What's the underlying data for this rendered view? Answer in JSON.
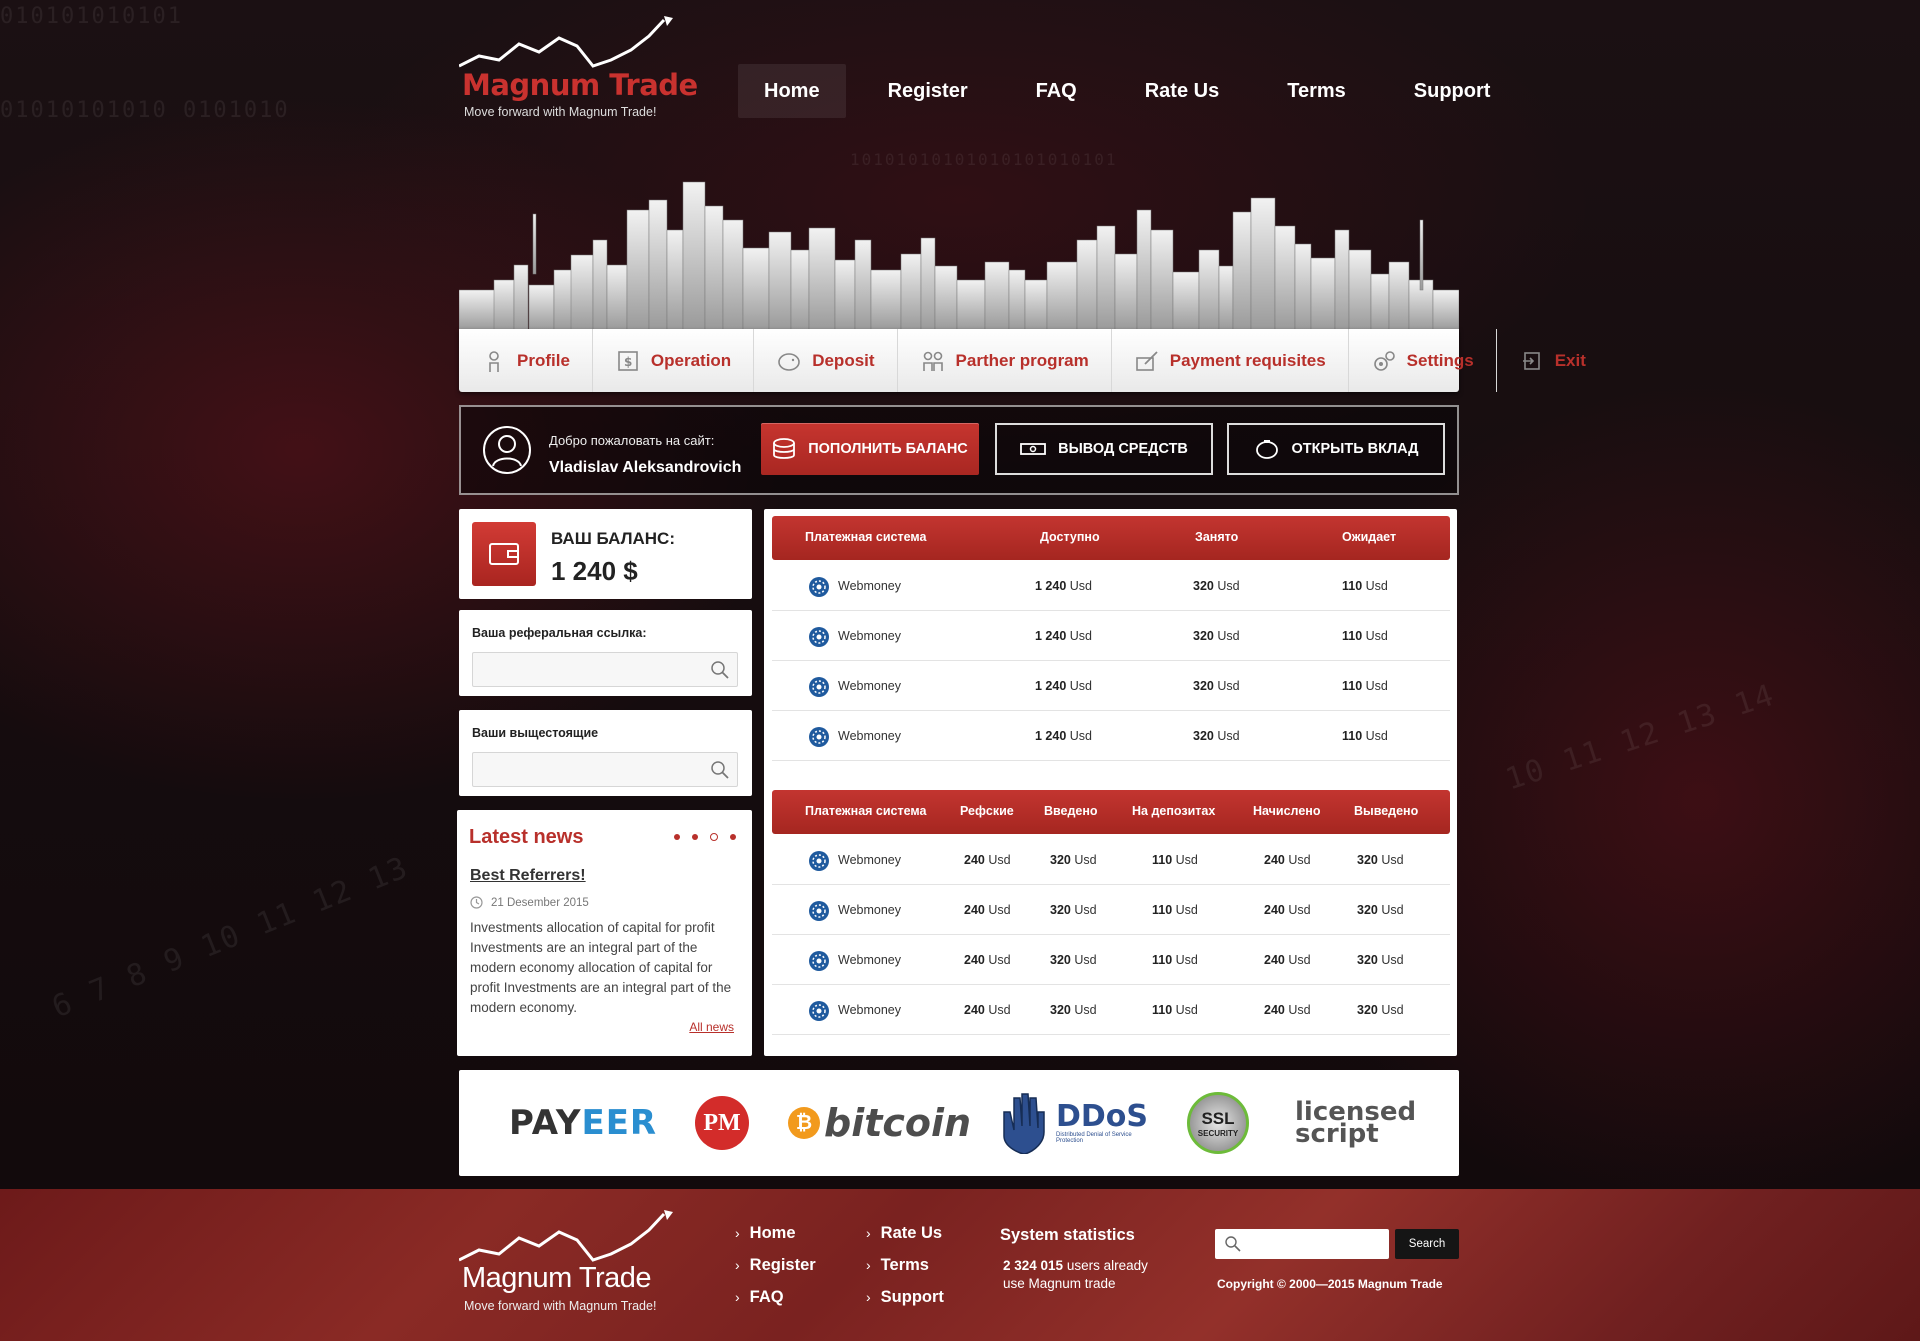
{
  "brand": {
    "name": "Magnum Trade",
    "tagline": "Move forward with Magnum Trade!",
    "accent_color": "#c9322f"
  },
  "nav": [
    {
      "label": "Home",
      "active": true
    },
    {
      "label": "Register"
    },
    {
      "label": "FAQ"
    },
    {
      "label": "Rate Us"
    },
    {
      "label": "Terms"
    },
    {
      "label": "Support"
    }
  ],
  "menu": [
    {
      "label": "Profile",
      "icon": "profile-icon"
    },
    {
      "label": "Operation",
      "icon": "operation-icon"
    },
    {
      "label": "Deposit",
      "icon": "deposit-icon"
    },
    {
      "label": "Parther program",
      "icon": "partner-icon"
    },
    {
      "label": "Payment requisites",
      "icon": "payment-icon"
    },
    {
      "label": "Settings",
      "icon": "settings-icon"
    },
    {
      "label": "Exit",
      "icon": "exit-icon"
    }
  ],
  "welcome": {
    "greeting": "Добро пожаловать на сайт:",
    "username": "Vladislav Aleksandrovich",
    "btn_topup": "ПОПОЛНИТЬ БАЛАНС",
    "btn_withdraw": "ВЫВОД СРЕДСТВ",
    "btn_deposit": "ОТКРЫТЬ ВКЛАД"
  },
  "balance": {
    "label": "ВАШ БАЛАНС:",
    "value": "1 240 $"
  },
  "referral": {
    "link_label": "Ваша реферальная ссылка:",
    "upline_label": "Ваши выщестоящие"
  },
  "news": {
    "title": "Latest news",
    "headline": "Best Referrers!",
    "date": "21 Desember 2015",
    "body": "Investments allocation of capital for profit Investments are an integral part of the modern economy allocation of capital for profit  Investments are an integral part of the modern economy.",
    "all_link": "All news"
  },
  "table1": {
    "headers": [
      "Платежная система",
      "Доступно",
      "Занято",
      "Ожидает"
    ],
    "rows": [
      {
        "system": "Webmoney",
        "c1": "1 240",
        "c2": "320",
        "c3": "110"
      },
      {
        "system": "Webmoney",
        "c1": "1 240",
        "c2": "320",
        "c3": "110"
      },
      {
        "system": "Webmoney",
        "c1": "1 240",
        "c2": "320",
        "c3": "110"
      },
      {
        "system": "Webmoney",
        "c1": "1 240",
        "c2": "320",
        "c3": "110"
      }
    ]
  },
  "table2": {
    "headers": [
      "Платежная система",
      "Рефские",
      "Введено",
      "На депозитах",
      "Начислено",
      "Выведено"
    ],
    "rows": [
      {
        "system": "Webmoney",
        "c1": "240",
        "c2": "320",
        "c3": "110",
        "c4": "240",
        "c5": "320"
      },
      {
        "system": "Webmoney",
        "c1": "240",
        "c2": "320",
        "c3": "110",
        "c4": "240",
        "c5": "320"
      },
      {
        "system": "Webmoney",
        "c1": "240",
        "c2": "320",
        "c3": "110",
        "c4": "240",
        "c5": "320"
      },
      {
        "system": "Webmoney",
        "c1": "240",
        "c2": "320",
        "c3": "110",
        "c4": "240",
        "c5": "320"
      }
    ]
  },
  "unit": "Usd",
  "partners": {
    "payeer_a": "PAY",
    "payeer_b": "EER",
    "pm": "PM",
    "bitcoin": "bitcoin",
    "ddos": "DDoS",
    "ddos_sub": "Distributed Denial of Service Protection",
    "ssl_top": "SSL",
    "ssl_bottom": "SECURITY",
    "licensed_1": "licensed",
    "licensed_2": "script"
  },
  "footer": {
    "links_col1": [
      "Home",
      "Register",
      "FAQ"
    ],
    "links_col2": [
      "Rate Us",
      "Terms",
      "Support"
    ],
    "stats_title": "System statistics",
    "stats_count": "2 324 015",
    "stats_text1": "users already",
    "stats_text2": "use Magnum trade",
    "search_button": "Search",
    "copyright": "Copyright  ©  2000—2015 Magnum Trade"
  }
}
